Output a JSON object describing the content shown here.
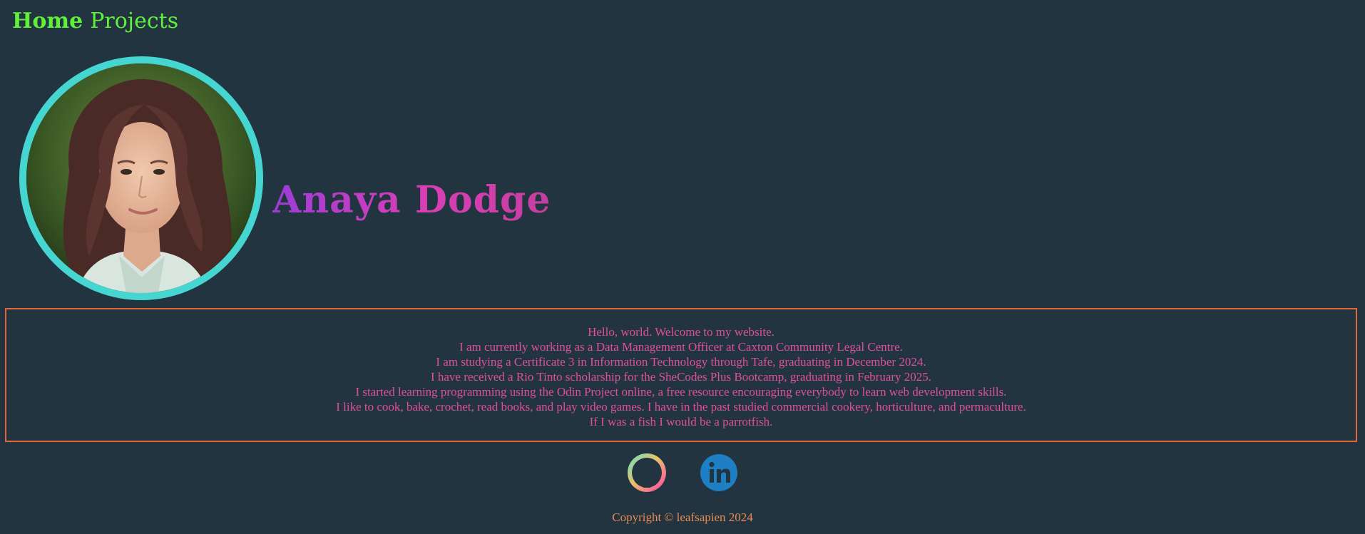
{
  "nav": {
    "home_label": "Home",
    "projects_label": "Projects"
  },
  "profile": {
    "name": "Anaya Dodge",
    "avatar_alt": "portrait photo"
  },
  "intro": {
    "lines": [
      "Hello, world. Welcome to my website.",
      "I am currently working as a Data Management Officer at Caxton Community Legal Centre.",
      "I am studying a Certificate 3 in Information Technology through Tafe, graduating in December 2024.",
      "I have received a Rio Tinto scholarship for the SheCodes Plus Bootcamp, graduating in February 2025.",
      "I started learning programming using the Odin Project online, a free resource encouraging everybody to learn web development skills.",
      "I like to cook, bake, crochet, read books, and play video games. I have in the past studied commercial cookery, horticulture, and permaculture.",
      "If I was a fish I would be a parrotfish."
    ]
  },
  "socials": {
    "github_icon": "github-icon",
    "linkedin_icon": "linkedin-icon"
  },
  "footer": {
    "copyright": "Copyright © leafsapien 2024"
  },
  "colors": {
    "background": "#233441",
    "nav": "#5ff03a",
    "avatar_border": "#45d6d2",
    "intro_text": "#e04f9a",
    "intro_border": "#e0683b",
    "footer_text": "#e98a52",
    "linkedin": "#1f7fc4"
  }
}
